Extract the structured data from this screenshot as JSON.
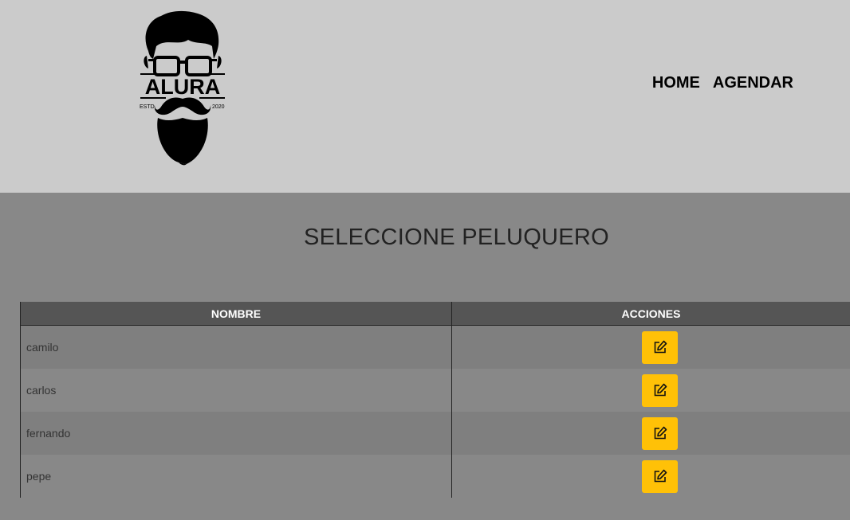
{
  "brand": {
    "logo_text": "ALURA",
    "logo_est": "ESTD",
    "logo_year": "2020"
  },
  "nav": {
    "items": [
      {
        "label": "HOME"
      },
      {
        "label": "AGENDAR"
      }
    ]
  },
  "page": {
    "title": "SELECCIONE PELUQUERO"
  },
  "table": {
    "headers": {
      "name": "NOMBRE",
      "actions": "ACCIONES"
    },
    "rows": [
      {
        "name": "camilo",
        "action_icon": "edit-icon"
      },
      {
        "name": "carlos",
        "action_icon": "edit-icon"
      },
      {
        "name": "fernando",
        "action_icon": "edit-icon"
      },
      {
        "name": "pepe",
        "action_icon": "edit-icon"
      }
    ]
  },
  "colors": {
    "header_bg": "#cbcbcb",
    "page_bg": "#888888",
    "table_header_bg": "#555555",
    "button_bg": "#ffc107"
  }
}
